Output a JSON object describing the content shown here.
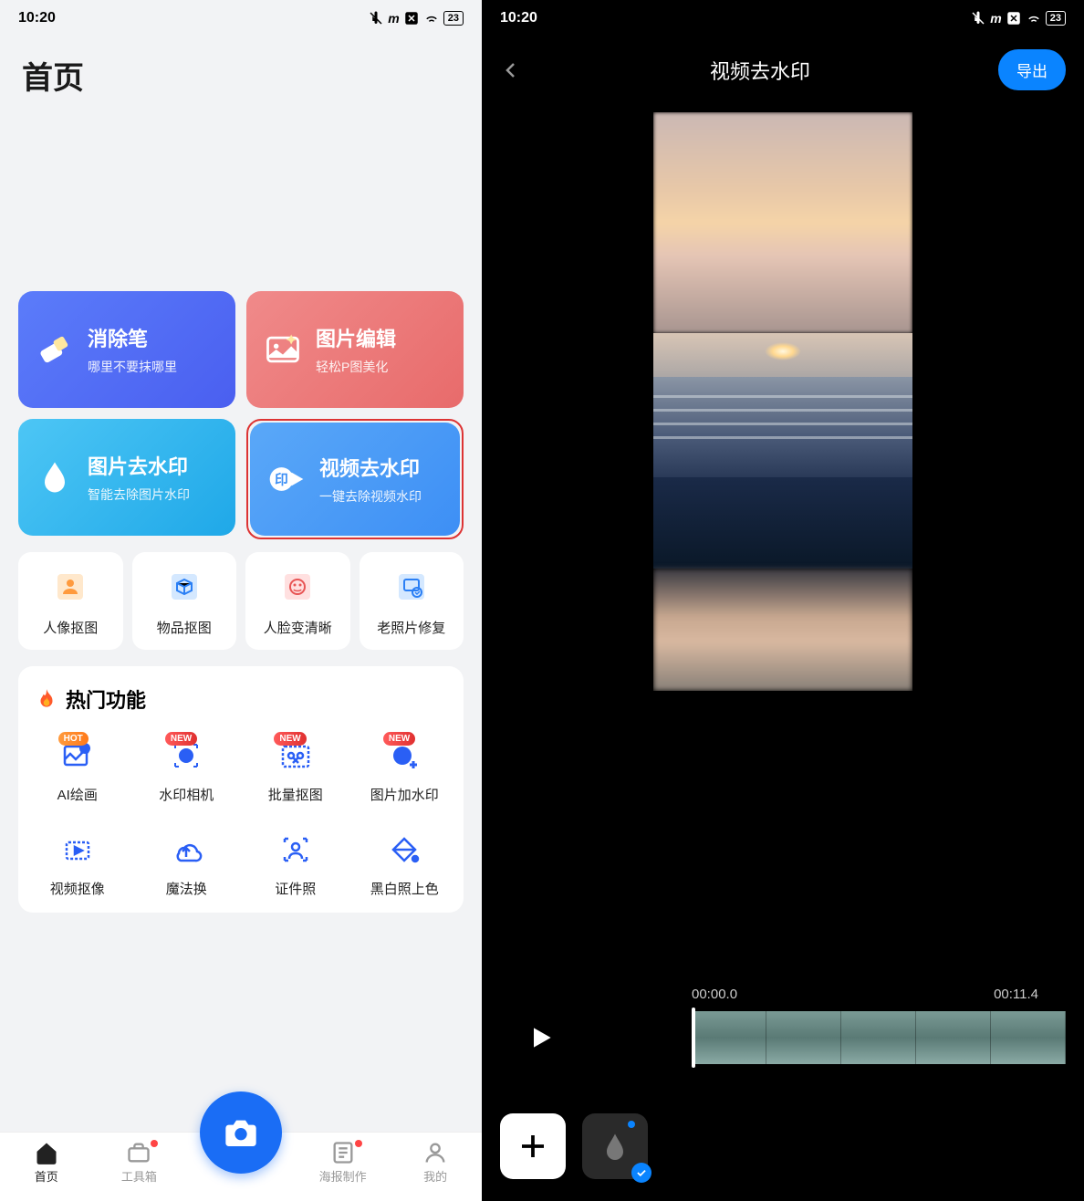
{
  "left": {
    "status": {
      "time": "10:20",
      "battery": "23"
    },
    "page_title": "首页",
    "cards": {
      "eraser": {
        "title": "消除笔",
        "sub": "哪里不要抹哪里"
      },
      "edit": {
        "title": "图片编辑",
        "sub": "轻松P图美化"
      },
      "img_wm": {
        "title": "图片去水印",
        "sub": "智能去除图片水印"
      },
      "vid_wm": {
        "title": "视频去水印",
        "sub": "一键去除视频水印"
      }
    },
    "small_tools": [
      "人像抠图",
      "物品抠图",
      "人脸变清晰",
      "老照片修复"
    ],
    "hot_section_title": "热门功能",
    "hot": [
      {
        "label": "AI绘画",
        "badge": "HOT",
        "badge_type": "hot"
      },
      {
        "label": "水印相机",
        "badge": "NEW",
        "badge_type": "new"
      },
      {
        "label": "批量抠图",
        "badge": "NEW",
        "badge_type": "new"
      },
      {
        "label": "图片加水印",
        "badge": "NEW",
        "badge_type": "new"
      },
      {
        "label": "视频抠像",
        "badge": "",
        "badge_type": ""
      },
      {
        "label": "魔法换",
        "badge": "",
        "badge_type": ""
      },
      {
        "label": "证件照",
        "badge": "",
        "badge_type": ""
      },
      {
        "label": "黑白照上色",
        "badge": "",
        "badge_type": ""
      }
    ],
    "nav": {
      "home": "首页",
      "toolbox": "工具箱",
      "poster": "海报制作",
      "mine": "我的"
    }
  },
  "right": {
    "status": {
      "time": "10:20",
      "battery": "23"
    },
    "title": "视频去水印",
    "export": "导出",
    "time_start": "00:00.0",
    "time_end": "00:11.4"
  }
}
